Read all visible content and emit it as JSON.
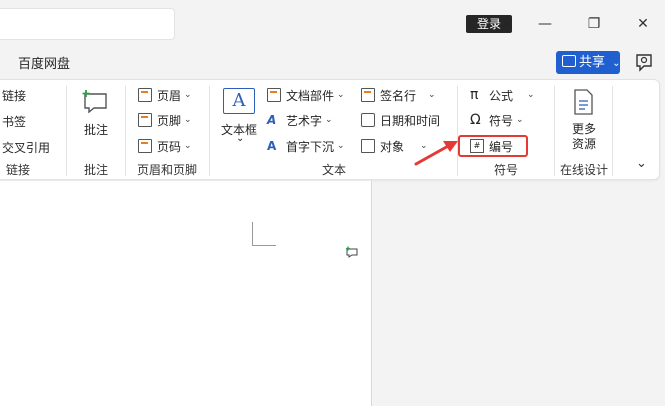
{
  "titlebar": {
    "login_label": "登录",
    "min_glyph": "—",
    "restore_glyph": "❐",
    "close_glyph": "✕"
  },
  "menu": {
    "tab_label": "百度网盘"
  },
  "share": {
    "label": "共享",
    "chevron": "⌄"
  },
  "ribbon": {
    "links": {
      "items": [
        "链接",
        "书签",
        "交叉引用"
      ],
      "group_label": "链接"
    },
    "comments": {
      "button_label": "批注",
      "group_label": "批注"
    },
    "header_footer": {
      "items": [
        "页眉",
        "页脚",
        "页码"
      ],
      "group_label": "页眉和页脚"
    },
    "text": {
      "textbox_label": "文本框",
      "textbox_glyph": "A",
      "col1": [
        "文档部件",
        "艺术字",
        "首字下沉"
      ],
      "col2": [
        "签名行",
        "日期和时间",
        "对象"
      ],
      "group_label": "文本"
    },
    "symbols": {
      "items": [
        "公式",
        "符号",
        "编号"
      ],
      "group_label": "符号"
    },
    "online_design": {
      "button_label_line1": "更多",
      "button_label_line2": "资源",
      "group_label": "在线设计"
    },
    "collapse_chevron": "⌄"
  },
  "colors": {
    "accent": "#1f5fd0",
    "highlight": "#e53935",
    "arrow": "#e53935",
    "icon_orange": "#e67e22",
    "icon_blue": "#2b5fb8",
    "icon_green": "#2e9e47"
  }
}
